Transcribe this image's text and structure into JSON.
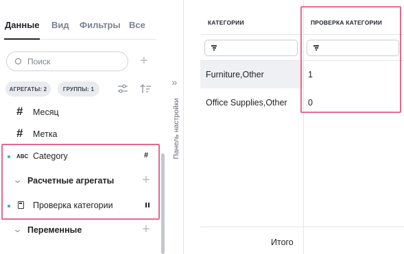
{
  "tabs": [
    "Данные",
    "Вид",
    "Фильтры",
    "Все"
  ],
  "search": {
    "placeholder": "Поиск"
  },
  "chips": {
    "aggregates": "АГРЕГАТЫ: 2",
    "groups": "ГРУППЫ: 1"
  },
  "fields": {
    "month": "Месяц",
    "label": "Метка",
    "category": "Category",
    "category_type": "ABC",
    "calc_aggregates": "Расчетные агрегаты",
    "check_category": "Проверка категории",
    "variables": "Переменные"
  },
  "side_panel": {
    "label": "Панель настройки"
  },
  "table": {
    "headers": [
      "КАТЕГОРИИ",
      "ПРОВЕРКА КАТЕГОРИИ"
    ],
    "rows": [
      [
        "Furniture,Other",
        "1"
      ],
      [
        "Office Supplies,Other",
        "0"
      ]
    ],
    "total_label": "Итого"
  },
  "colors": {
    "highlight": "#e8678b",
    "accent_dot": "#3bbfa6"
  },
  "icons": [
    "search-icon",
    "plus-icon",
    "settings-sliders-icon",
    "sort-icon",
    "hash-icon",
    "abc-icon",
    "chevron-down-icon",
    "calculator-icon",
    "pause-icon",
    "double-chevron-right-icon",
    "filter-icon"
  ]
}
